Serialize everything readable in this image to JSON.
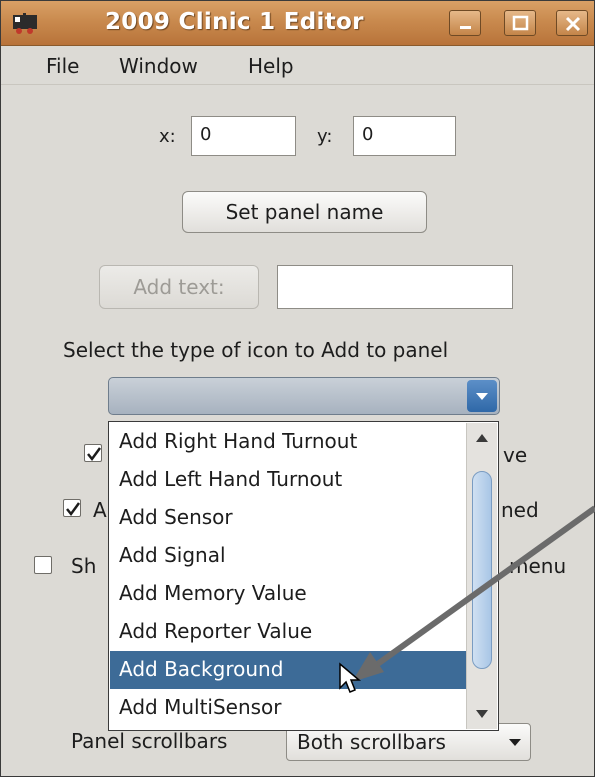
{
  "window": {
    "title": "2009 Clinic 1 Editor"
  },
  "menubar": {
    "items": [
      "File",
      "Window",
      "Help"
    ]
  },
  "coords": {
    "x_label": "x:",
    "x_value": "0",
    "y_label": "y:",
    "y_value": "0"
  },
  "buttons": {
    "set_panel_name": "Set panel name",
    "add_text": "Add text:"
  },
  "add_text_field": {
    "value": ""
  },
  "icon_type": {
    "prompt": "Select the type of icon to Add to panel",
    "selected": ""
  },
  "dropdown": {
    "options": [
      "Add Right Hand Turnout",
      "Add Left Hand Turnout",
      "Add Sensor",
      "Add Signal",
      "Add Memory Value",
      "Add Reporter Value",
      "Add Background",
      "Add MultiSensor"
    ],
    "highlighted": "Add Background"
  },
  "partial_labels": {
    "row1_suffix": "ve",
    "row2_prefix": "A",
    "row2_suffix": "ned",
    "row3_prefix": "Sh",
    "row3_suffix": "menu"
  },
  "checkboxes": {
    "row1_checked": true,
    "row2_checked": true,
    "row3_checked": false
  },
  "scrollbars": {
    "label": "Panel scrollbars",
    "value": "Both scrollbars"
  },
  "colors": {
    "selection": "#3d6b97",
    "titlebar": "#c98a4e",
    "annotation_arrow": "#6b6b6b"
  }
}
